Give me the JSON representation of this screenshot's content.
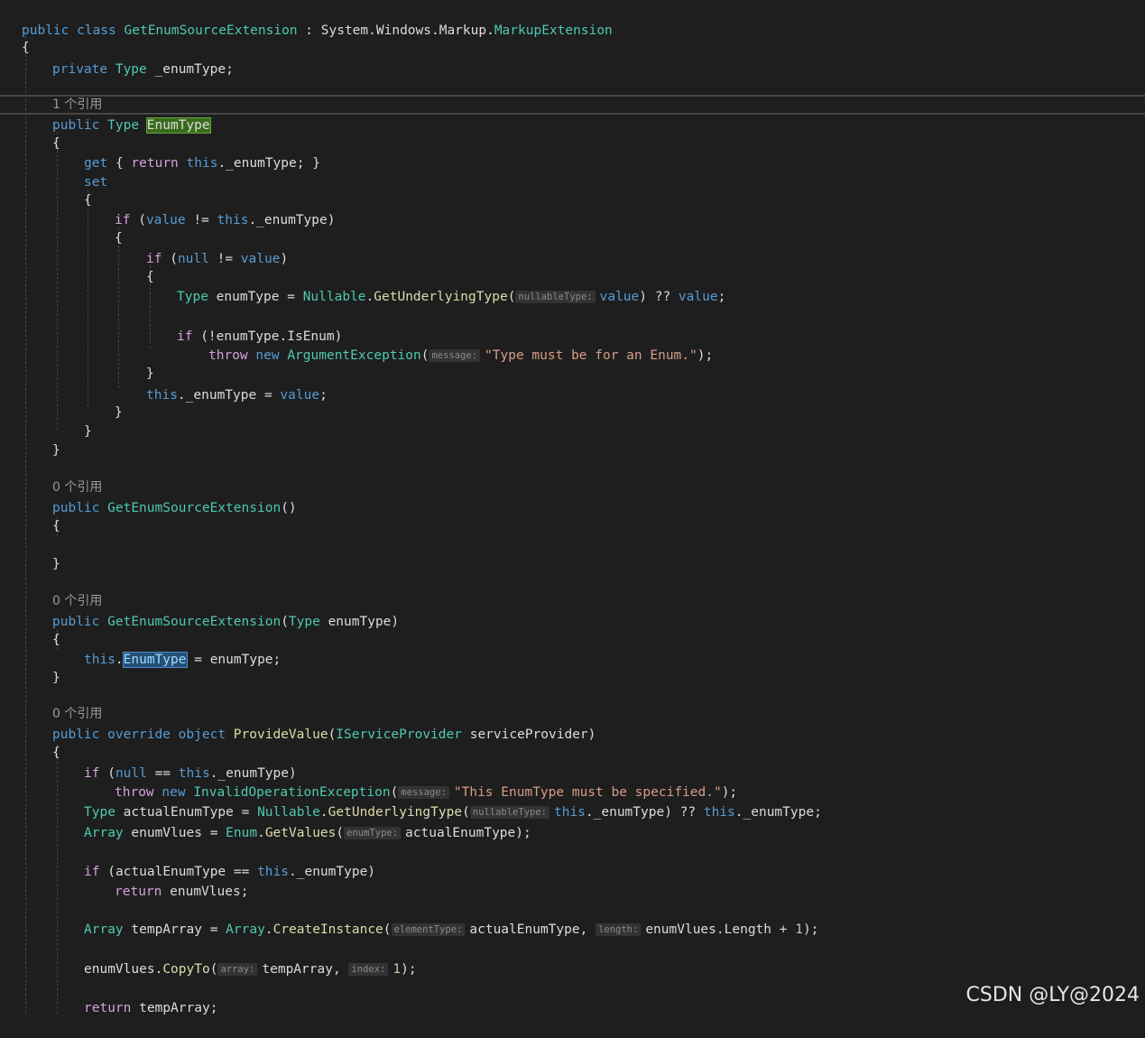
{
  "code": {
    "class_decl": {
      "kw": "public class",
      "name": "GetEnumSourceExtension",
      "sep": " : ",
      "ns": "System.Windows.Markup.",
      "base": "MarkupExtension"
    },
    "brace_open": "{",
    "brace_close": "}",
    "field_decl": {
      "kw": "private",
      "type": "Type",
      "rest": "_enumType;"
    },
    "lens_1": "1 个引用",
    "prop_decl": {
      "kw": "public",
      "type": "Type",
      "name": "EnumType"
    },
    "getter": {
      "kw": "get",
      "open": "{",
      "ret": "return",
      "this": "this",
      "rest": "._enumType; }"
    },
    "setter_kw": "set",
    "if_value": {
      "kw": "if",
      "open": " (",
      "value": "value",
      "op": " != ",
      "this": "this",
      "rest": "._enumType)"
    },
    "if_null": {
      "kw": "if",
      "open": " (",
      "null": "null",
      "op": " != ",
      "value": "value",
      "close": ")"
    },
    "underlying_1": {
      "type": "Type",
      "var": "enumType",
      "eq": " = ",
      "cls": "Nullable",
      "dot": ".",
      "method": "GetUnderlyingType",
      "paren": "(",
      "hint": "nullableType:",
      "value": "value",
      "mid": ") ?? ",
      "value2": "value",
      "end": ";"
    },
    "if_isenum": {
      "kw": "if",
      "open": " (!",
      "var": "enumType",
      "rest": ".IsEnum)"
    },
    "throw_1": {
      "kw": "throw",
      "new": "new",
      "cls": "ArgumentException",
      "paren": "(",
      "hint": "message:",
      "str": "\"Type must be for an Enum.\"",
      "end": ");"
    },
    "assign_field": {
      "this": "this",
      "mid": "._enumType = ",
      "value": "value",
      "end": ";"
    },
    "lens_0a": "0 个引用",
    "ctor_empty": {
      "kw": "public",
      "name": "GetEnumSourceExtension",
      "rest": "()"
    },
    "lens_0b": "0 个引用",
    "ctor_type": {
      "kw": "public",
      "name": "GetEnumSourceExtension",
      "paren": "(",
      "type": "Type",
      "param": "enumType",
      "close": ")"
    },
    "ctor_assign": {
      "this": "this",
      "dot": ".",
      "prop": "EnumType",
      "eq": " = ",
      "param": "enumType",
      "end": ";"
    },
    "lens_0c": "0 个引用",
    "provide_decl": {
      "kw": "public override object",
      "name": "ProvideValue",
      "paren": "(",
      "type": "IServiceProvider",
      "param": "serviceProvider",
      "close": ")"
    },
    "if_null_field": {
      "kw": "if",
      "open": " (",
      "null": "null",
      "op": " == ",
      "this": "this",
      "rest": "._enumType)"
    },
    "throw_2": {
      "kw": "throw",
      "new": "new",
      "cls": "InvalidOperationException",
      "paren": "(",
      "hint": "message:",
      "str": "\"This EnumType must be specified.\"",
      "end": ");"
    },
    "actual_type": {
      "type": "Type",
      "var": "actualEnumType",
      "eq": " = ",
      "cls": "Nullable",
      "dot": ".",
      "method": "GetUnderlyingType",
      "paren": "(",
      "hint": "nullableType:",
      "this": "this",
      "mid": "._enumType) ?? ",
      "this2": "this",
      "end": "._enumType;"
    },
    "get_values": {
      "type": "Array",
      "var": "enumVlues",
      "eq": " = ",
      "cls": "Enum",
      "dot": ".",
      "method": "GetValues",
      "paren": "(",
      "hint": "enumType:",
      "arg": "actualEnumType",
      "end": ");"
    },
    "if_actual": {
      "kw": "if",
      "open": " (",
      "var": "actualEnumType",
      "op": " == ",
      "this": "this",
      "rest": "._enumType)"
    },
    "return_values": {
      "kw": "return",
      "var": "enumVlues",
      "end": ";"
    },
    "create_instance": {
      "type": "Array",
      "var": "tempArray",
      "eq": " = ",
      "cls": "Array",
      "dot": ".",
      "method": "CreateInstance",
      "paren": "(",
      "hint1": "elementType:",
      "arg1": "actualEnumType",
      "comma": ", ",
      "hint2": "length:",
      "arg2": "enumVlues",
      "len": ".Length + ",
      "num": "1",
      "end": ");"
    },
    "copy_to": {
      "var": "enumVlues",
      "dot": ".",
      "method": "CopyTo",
      "paren": "(",
      "hint1": "array:",
      "arg1": "tempArray",
      "comma": ", ",
      "hint2": "index:",
      "num": "1",
      "end": ");"
    },
    "return_temp": {
      "kw": "return",
      "var": "tempArray",
      "end": ";"
    }
  },
  "watermark": "CSDN @LY@2024",
  "colors": {
    "background": "#1e1e1e",
    "keyword": "#569cd6",
    "control": "#d8a0df",
    "type": "#4ec9b0",
    "method": "#dcdcaa",
    "string": "#d69d85",
    "number": "#b5cea8",
    "variable": "#9cdcfe"
  }
}
